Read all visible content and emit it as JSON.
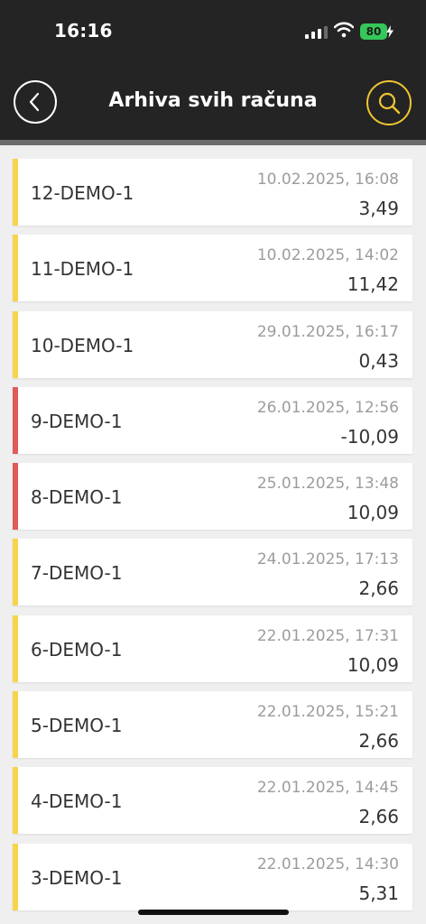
{
  "status_bar": {
    "time": "16:16",
    "battery": "80"
  },
  "header": {
    "title": "Arhiva svih računa",
    "back_icon": "chevron-left-icon",
    "search_icon": "search-icon"
  },
  "colors": {
    "header_bg": "#242424",
    "accent_yellow": "#f7d44c",
    "accent_red": "#e05a5a",
    "search_ring": "#f0c531"
  },
  "receipts": [
    {
      "number": "12-DEMO-1",
      "date": "10.02.2025, 16:08",
      "amount": "3,49",
      "status": "yellow"
    },
    {
      "number": "11-DEMO-1",
      "date": "10.02.2025, 14:02",
      "amount": "11,42",
      "status": "yellow"
    },
    {
      "number": "10-DEMO-1",
      "date": "29.01.2025, 16:17",
      "amount": "0,43",
      "status": "yellow"
    },
    {
      "number": "9-DEMO-1",
      "date": "26.01.2025, 12:56",
      "amount": "-10,09",
      "status": "red"
    },
    {
      "number": "8-DEMO-1",
      "date": "25.01.2025, 13:48",
      "amount": "10,09",
      "status": "red"
    },
    {
      "number": "7-DEMO-1",
      "date": "24.01.2025, 17:13",
      "amount": "2,66",
      "status": "yellow"
    },
    {
      "number": "6-DEMO-1",
      "date": "22.01.2025, 17:31",
      "amount": "10,09",
      "status": "yellow"
    },
    {
      "number": "5-DEMO-1",
      "date": "22.01.2025, 15:21",
      "amount": "2,66",
      "status": "yellow"
    },
    {
      "number": "4-DEMO-1",
      "date": "22.01.2025, 14:45",
      "amount": "2,66",
      "status": "yellow"
    },
    {
      "number": "3-DEMO-1",
      "date": "22.01.2025, 14:30",
      "amount": "5,31",
      "status": "yellow"
    }
  ]
}
